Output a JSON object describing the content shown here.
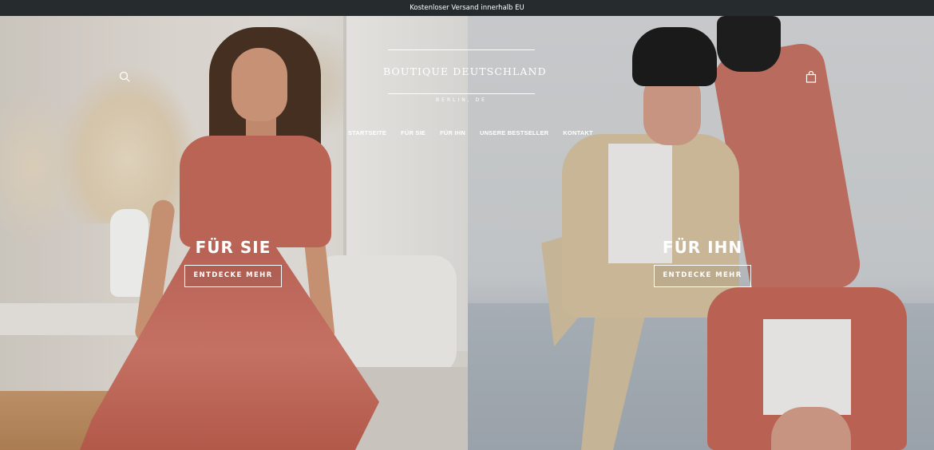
{
  "announcement": {
    "text": "Kostenloser Versand innerhalb EU"
  },
  "header": {
    "logo_title": "BOUTIQUE DEUTSCHLAND",
    "logo_subtitle": "BERLIN, DE",
    "search_icon": "search-icon",
    "cart_icon": "shopping-bag-icon",
    "nav": [
      {
        "label": "STARTSEITE"
      },
      {
        "label": "FÜR SIE"
      },
      {
        "label": "FÜR IHN"
      },
      {
        "label": "UNSERE BESTSELLER"
      },
      {
        "label": "KONTAKT"
      }
    ]
  },
  "hero": {
    "left": {
      "heading": "FÜR SIE",
      "button_label": "ENTDECKE MEHR"
    },
    "right": {
      "heading": "FÜR IHN",
      "button_label": "ENTDECKE MEHR"
    }
  },
  "colors": {
    "announcement_bg": "#262c2e",
    "text_on_image": "#ffffff"
  }
}
